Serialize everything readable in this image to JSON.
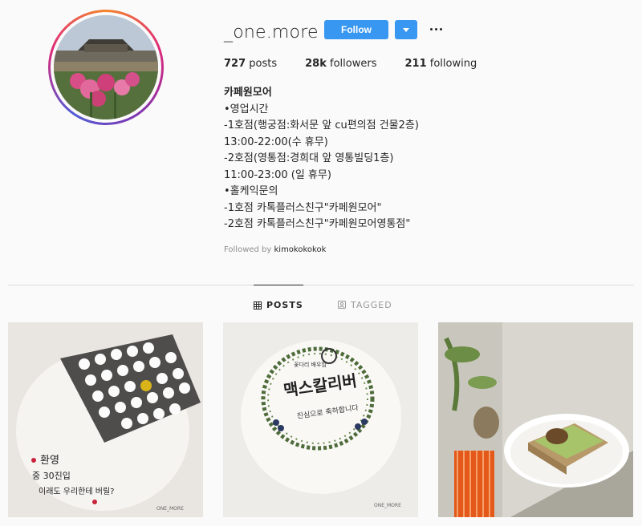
{
  "profile": {
    "username": "_one.more",
    "follow_label": "Follow",
    "stats": [
      {
        "value": "727",
        "label": "posts"
      },
      {
        "value": "28k",
        "label": "followers"
      },
      {
        "value": "211",
        "label": "following"
      }
    ],
    "bio_name": "카페원모어",
    "bio_lines": [
      "•영업시간",
      "-1호점(행궁점:화서문 앞 cu편의점 건물2층)",
      "13:00-22:00(수 휴무)",
      "-2호점(영통점:경희대 앞 영통빌딩1층)",
      "11:00-23:00 (일 휴무)",
      "•홀케익문의",
      "-1호점 카톡플러스친구\"카페원모어\"",
      "-2호점 카톡플러스친구\"카페원모어영통점\""
    ],
    "followed_by_prefix": "Followed by",
    "followed_by_user": "kimokokokok"
  },
  "tabs": {
    "posts": "POSTS",
    "tagged": "TAGGED"
  },
  "posts": [
    {
      "alt_icon": "egg-cake-image",
      "caption_text": [
        "환영",
        "중 30진입",
        "이래도 우리한테 버릴?",
        "ONE_MORE"
      ]
    },
    {
      "alt_icon": "wreath-cake-image",
      "caption_text": [
        "꽃다리 배우임",
        "맥스칼리버",
        "진심으로 축하합니다",
        "ONE_MORE"
      ]
    },
    {
      "alt_icon": "avocado-cake-image",
      "caption_text": []
    }
  ],
  "colors": {
    "accent": "#3897f0",
    "text": "#262626",
    "muted": "#8e8e8e",
    "divider": "#dbdbdb",
    "background": "#fafafa"
  }
}
